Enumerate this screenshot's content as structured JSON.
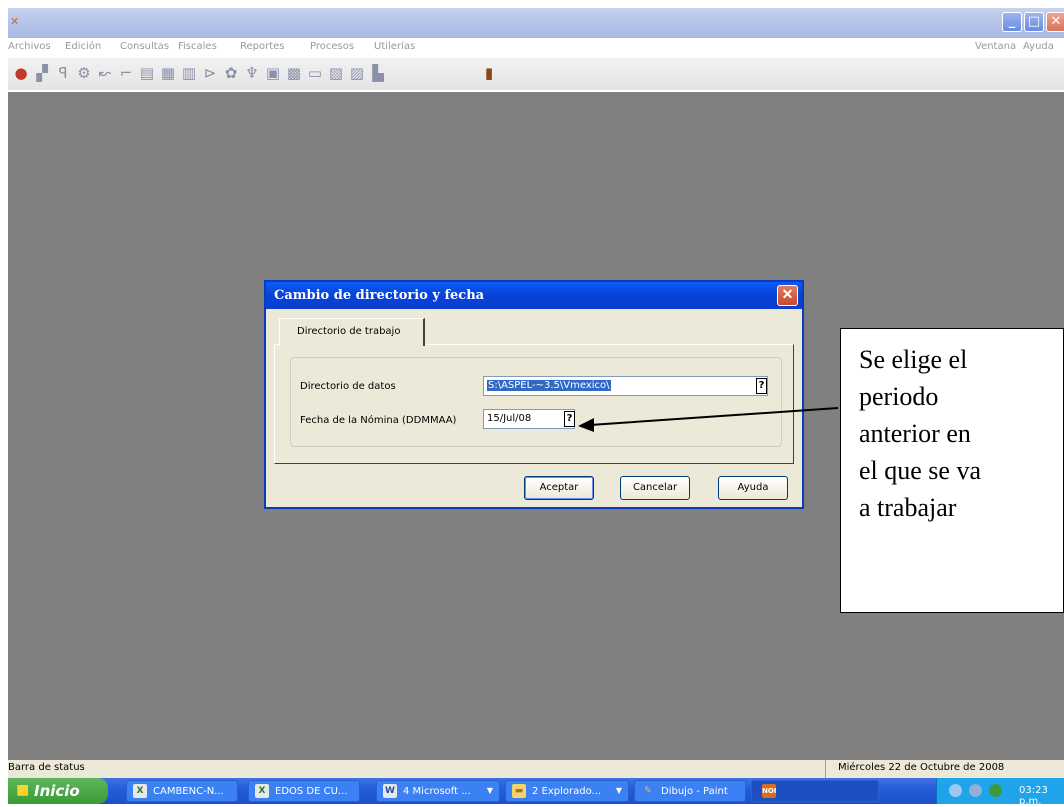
{
  "window": {
    "app_icon": "nomina-app-icon",
    "controls": [
      "minimize",
      "maximize",
      "close"
    ]
  },
  "menubar": {
    "items": [
      "Archivos",
      "Edición",
      "Consultas",
      "Fiscales",
      "Reportes",
      "Procesos",
      "Utilerías"
    ],
    "right_items": [
      "Ventana",
      "Ayuda"
    ]
  },
  "toolbar": {
    "icons": [
      "employee-icon",
      "tool-2-icon",
      "tool-3-icon",
      "tool-4-icon",
      "tool-5-icon",
      "tool-6-icon",
      "tool-7-icon",
      "tool-8-icon",
      "tool-9-icon",
      "tool-10-icon",
      "tool-11-icon",
      "tool-12-icon",
      "tool-13-icon",
      "tool-14-icon",
      "tool-15-icon",
      "tool-16-icon",
      "tool-17-icon",
      "exit-door-icon"
    ]
  },
  "dialog": {
    "title": "Cambio de directorio y fecha",
    "tab_label": "Directorio de trabajo",
    "data_dir_label": "Directorio de datos",
    "data_dir_value": "S:\\ASPEL-~3.5\\Vmexico\\",
    "date_label": "Fecha de la Nómina (DDMMAA)",
    "date_value": "15/Jul/08",
    "help_glyph": "?",
    "buttons": {
      "accept": "Aceptar",
      "cancel": "Cancelar",
      "help": "Ayuda"
    }
  },
  "annotation": {
    "lines": [
      "Se elige el",
      "periodo",
      "anterior en",
      "el que se va",
      "a trabajar"
    ]
  },
  "statusbar": {
    "left": "Barra de status",
    "right": "Miércoles 22 de Octubre de 2008"
  },
  "taskbar": {
    "start_label": "Inicio",
    "tasks": [
      {
        "label": "CAMBENC-N..."
      },
      {
        "label": "EDOS DE CU..."
      },
      {
        "label": "4 Microsoft ..."
      },
      {
        "label": "2 Explorado..."
      },
      {
        "label": "Dibujo - Paint"
      },
      {
        "label": "NOI"
      }
    ],
    "clock": "03:23 p.m."
  }
}
